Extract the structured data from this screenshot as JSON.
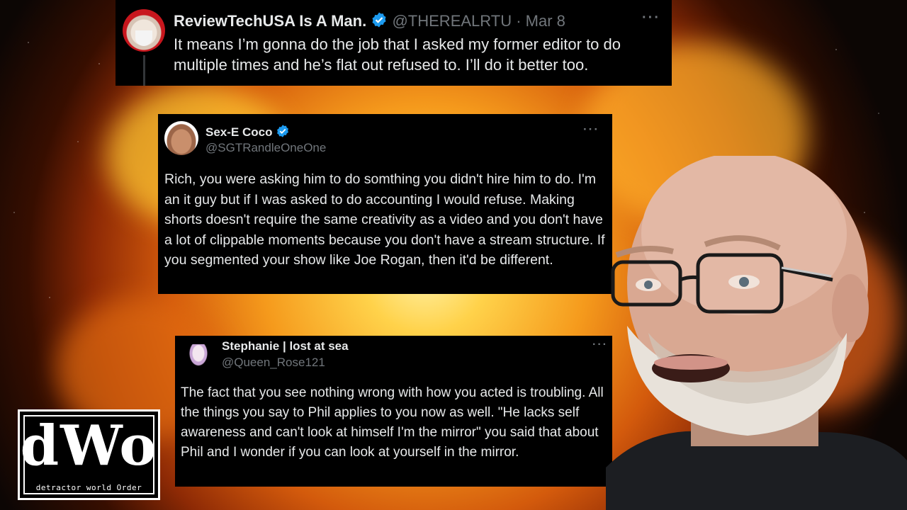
{
  "tweets": [
    {
      "name": "ReviewTechUSA Is A Man.",
      "handle": "@THEREALRTU",
      "date": "· Mar 8",
      "verified": true,
      "text": "It means I’m gonna do the job that I asked my former editor to do multiple times and he’s flat out refused to. I’ll do it better too."
    },
    {
      "name": "Sex-E Coco",
      "handle": "@SGTRandleOneOne",
      "verified": true,
      "text": "Rich, you were asking him to do somthing you didn't hire him to do. I'm an it guy but if I was asked to do accounting I would refuse. Making shorts doesn't require the same creativity as a video and you don't have a lot of clippable moments because you don't have a stream structure. If you segmented your show like Joe Rogan, then it'd be different."
    },
    {
      "name": "Stephanie | lost at sea",
      "handle": "@Queen_Rose121",
      "verified": false,
      "text": "The fact that you see nothing wrong with how you acted is troubling. All the things you say to Phil applies to you now as well. \"He lacks self awareness and can't look at himself I'm the mirror\" you said that about Phil and I wonder if you can look at yourself in the mirror."
    }
  ],
  "more_label": "···",
  "logo": {
    "mark": "dWo",
    "tagline": "detractor world Order"
  },
  "colors": {
    "verified": "#1d9bf0",
    "card_bg": "#000000",
    "text": "#e7e9ea",
    "muted": "#71767b"
  }
}
